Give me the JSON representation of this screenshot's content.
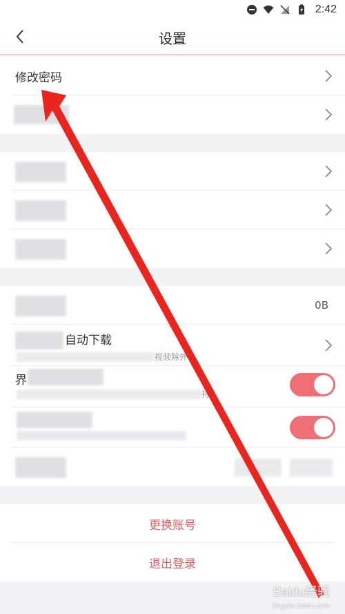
{
  "status_bar": {
    "time": "2:42"
  },
  "header": {
    "title": "设置"
  },
  "group1": {
    "items": [
      {
        "label": "修改密码"
      },
      {
        "label": ""
      }
    ]
  },
  "group3": {
    "cache_value": "0B",
    "auto_download_suffix": "自动下载",
    "auto_download_sub": "视频除外",
    "theme_label_prefix": "界",
    "theme_sub_suffix": "持"
  },
  "actions": {
    "switch_account": "更换账号",
    "logout": "退出登录"
  },
  "watermark": {
    "main": "Baidu经验",
    "sub": "jingyan.baidu.com"
  },
  "colors": {
    "accent": "#e25a5e",
    "toggle_on": "#ee6f76",
    "arrow": "#e8251e"
  }
}
